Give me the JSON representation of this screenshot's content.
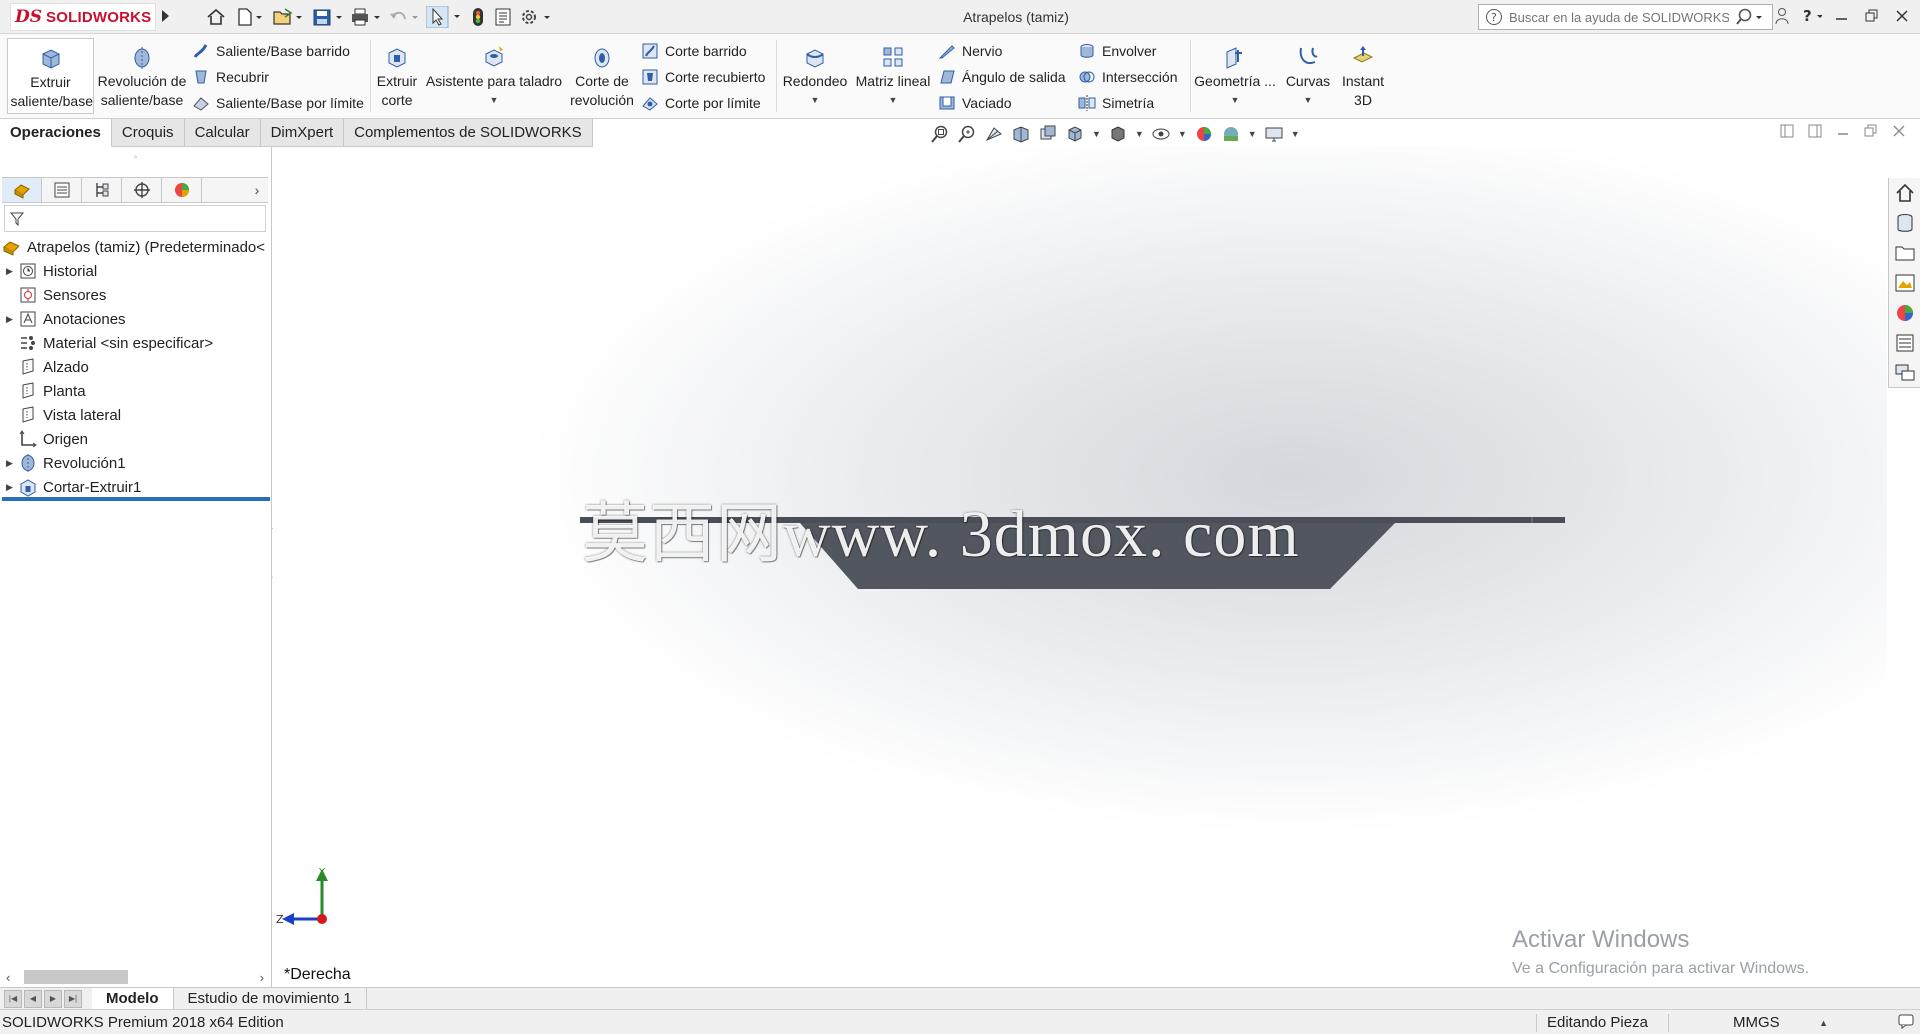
{
  "app": {
    "logo_ds": "DS",
    "logo_text": "SOLIDWORKS",
    "window_title": "Atrapelos (tamiz)",
    "search_placeholder": "Buscar en la ayuda de SOLIDWORKS"
  },
  "ribbon": {
    "extrude_boss": "Extruir saliente/base",
    "revolve_boss": "Revolución de saliente/base",
    "swept_boss": "Saliente/Base barrido",
    "loft_boss": "Recubrir",
    "boundary_boss": "Saliente/Base por límite",
    "extrude_cut": "Extruir corte",
    "hole_wizard": "Asistente para taladro",
    "revolve_cut": "Corte de revolución",
    "swept_cut": "Corte barrido",
    "loft_cut": "Corte recubierto",
    "boundary_cut": "Corte por límite",
    "fillet": "Redondeo",
    "linear_pattern": "Matriz lineal",
    "rib": "Nervio",
    "draft": "Ángulo de salida",
    "shell": "Vaciado",
    "wrap": "Envolver",
    "intersect": "Intersección",
    "mirror": "Simetría",
    "ref_geometry": "Geometría ...",
    "curves": "Curvas",
    "instant3d": "Instant 3D"
  },
  "tabs": [
    "Operaciones",
    "Croquis",
    "Calcular",
    "DimXpert",
    "Complementos de SOLIDWORKS"
  ],
  "tree": {
    "root": "Atrapelos (tamiz)  (Predeterminado<",
    "items": [
      {
        "label": "Historial",
        "expandable": true,
        "icon": "history-icon"
      },
      {
        "label": "Sensores",
        "expandable": false,
        "icon": "sensors-icon"
      },
      {
        "label": "Anotaciones",
        "expandable": true,
        "icon": "annotations-icon"
      },
      {
        "label": "Material <sin especificar>",
        "expandable": false,
        "icon": "material-icon"
      },
      {
        "label": "Alzado",
        "expandable": false,
        "icon": "plane-icon"
      },
      {
        "label": "Planta",
        "expandable": false,
        "icon": "plane-icon"
      },
      {
        "label": "Vista lateral",
        "expandable": false,
        "icon": "plane-icon"
      },
      {
        "label": "Origen",
        "expandable": false,
        "icon": "origin-icon"
      },
      {
        "label": "Revolución1",
        "expandable": true,
        "icon": "revolve-feature-icon"
      },
      {
        "label": "Cortar-Extruir1",
        "expandable": true,
        "icon": "cut-extrude-feature-icon"
      }
    ]
  },
  "viewport": {
    "view_name": "*Derecha",
    "watermark": "莫西网www. 3dmox. com",
    "triad_y": "Y",
    "triad_z": "Z",
    "activate_title": "Activar Windows",
    "activate_sub": "Ve a Configuración para activar Windows."
  },
  "bottom_tabs": [
    "Modelo",
    "Estudio de movimiento 1"
  ],
  "status": {
    "edition": "SOLIDWORKS Premium 2018 x64 Edition",
    "editing": "Editando Pieza",
    "units": "MMGS"
  },
  "colors": {
    "brand": "#c8102e",
    "part_fill": "#505560",
    "selection": "#2a6eb8"
  }
}
